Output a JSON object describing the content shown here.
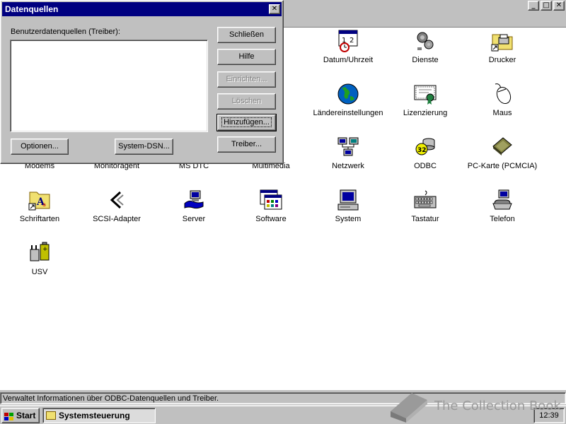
{
  "control_panel": {
    "window_buttons": [
      "_",
      "□",
      "✕"
    ],
    "icons": [
      {
        "label": "Datum/Uhrzeit",
        "icon": "calendar-clock-icon"
      },
      {
        "label": "Dienste",
        "icon": "gears-icon"
      },
      {
        "label": "Drucker",
        "icon": "printer-folder-icon"
      },
      {
        "label": "Ländereinstellungen",
        "icon": "globe-icon"
      },
      {
        "label": "Lizenzierung",
        "icon": "certificate-icon"
      },
      {
        "label": "Maus",
        "icon": "mouse-icon"
      },
      {
        "label": "Modems",
        "icon": "modem-icon"
      },
      {
        "label": "Monitoragent",
        "icon": "monitor-agent-icon"
      },
      {
        "label": "MS DTC",
        "icon": "msdtc-icon"
      },
      {
        "label": "Multimedia",
        "icon": "multimedia-icon"
      },
      {
        "label": "Netzwerk",
        "icon": "network-icon"
      },
      {
        "label": "ODBC",
        "icon": "odbc-icon"
      },
      {
        "label": "PC-Karte (PCMCIA)",
        "icon": "pc-card-icon"
      },
      {
        "label": "Schriftarten",
        "icon": "fonts-folder-icon"
      },
      {
        "label": "SCSI-Adapter",
        "icon": "scsi-icon"
      },
      {
        "label": "Server",
        "icon": "server-icon"
      },
      {
        "label": "Software",
        "icon": "software-icon"
      },
      {
        "label": "System",
        "icon": "computer-icon"
      },
      {
        "label": "Tastatur",
        "icon": "keyboard-icon"
      },
      {
        "label": "Telefon",
        "icon": "telephone-icon"
      },
      {
        "label": "USV",
        "icon": "ups-battery-icon"
      }
    ],
    "status_text": "Verwaltet Informationen über ODBC-Datenquellen und Treiber."
  },
  "dialog": {
    "title": "Datenquellen",
    "close": "✕",
    "list_label": "Benutzerdatenquellen (Treiber):",
    "buttons": {
      "schliessen": "Schließen",
      "hilfe": "Hilfe",
      "einrichten": "Einrichten...",
      "loeschen": "Löschen",
      "hinzufuegen": "Hinzufügen...",
      "treiber": "Treiber...",
      "optionen": "Optionen...",
      "system_dsn": "System-DSN..."
    }
  },
  "taskbar": {
    "start": "Start",
    "task": "Systemsteuerung",
    "clock": "12:39"
  },
  "watermark": "The Collection Book",
  "colors": {
    "titlebar": "#000080",
    "face": "#c0c0c0",
    "content": "#ffffff"
  }
}
